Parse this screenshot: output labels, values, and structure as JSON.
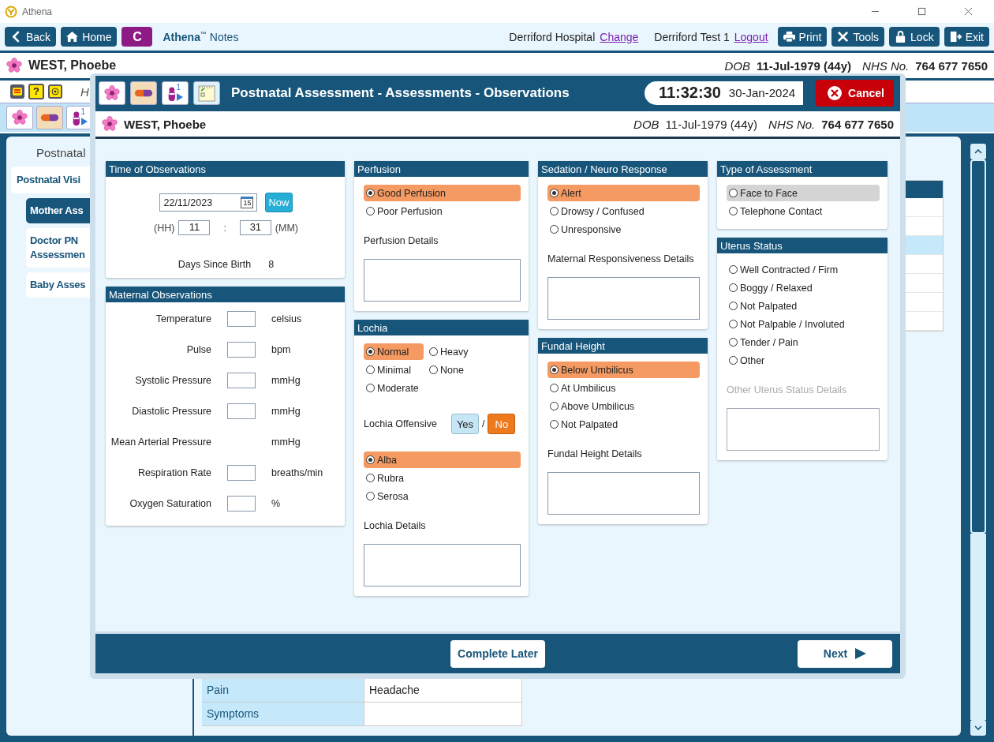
{
  "app": {
    "title": "Athena"
  },
  "toolbar": {
    "back": "Back",
    "home": "Home",
    "c_button": "C",
    "app_name": "Athena",
    "trademark": "™",
    "module": "Notes",
    "hospital": "Derriford Hospital",
    "change_link": "Change",
    "user": "Derriford Test 1",
    "logout_link": "Logout",
    "buttons": [
      {
        "kind": "print",
        "label": "Print"
      },
      {
        "kind": "tools",
        "label": "Tools"
      },
      {
        "kind": "lock",
        "label": "Lock"
      },
      {
        "kind": "exit",
        "label": "Exit"
      }
    ]
  },
  "patient": {
    "name": "WEST, Phoebe",
    "dob_label": "DOB",
    "dob": "11-Jul-1979 (44y)",
    "nhs_label": "NHS No.",
    "nhs": "764 677 7650"
  },
  "subheader": {
    "help_glyph": "?",
    "text": "H"
  },
  "icon_bar": {
    "badge": "1"
  },
  "nav": {
    "heading": "Postnatal",
    "items": [
      {
        "lines": [
          "Postnatal Visi"
        ],
        "selected": false,
        "children": [
          {
            "lines": [
              "Mother Ass"
            ],
            "selected": true
          },
          {
            "lines": [
              "Doctor PN",
              "Assessmen"
            ],
            "selected": false
          },
          {
            "lines": [
              "Baby Asses"
            ],
            "selected": false
          }
        ]
      }
    ]
  },
  "side_table": {
    "rows": [
      {
        "selected": false
      },
      {
        "selected": false
      },
      {
        "selected": true
      },
      {
        "selected": false
      },
      {
        "selected": false
      },
      {
        "selected": false
      },
      {
        "selected": false
      }
    ]
  },
  "bottom_table": {
    "rows": [
      {
        "label": "Pain",
        "value": "Headache"
      },
      {
        "label": "Symptoms"
      }
    ]
  },
  "modal": {
    "title": "Postnatal Assessment - Assessments - Observations",
    "badge": "1",
    "time": "11:32:30",
    "date": "30-Jan-2024",
    "cancel": "Cancel",
    "patient": {
      "name": "WEST, Phoebe",
      "dob_label": "DOB",
      "dob": "11-Jul-1979 (44y)",
      "nhs_label": "NHS No.",
      "nhs": "764 677 7650"
    },
    "columns": [
      [
        {
          "kind": "time",
          "title": "Time of Observations",
          "date": "22/11/2023",
          "calendar_day": "15",
          "now": "Now",
          "hh_label": "(HH)",
          "hour": "11",
          "separator": ":",
          "minute": "31",
          "mm_label": "(MM)",
          "days_label": "Days Since Birth",
          "days": "8"
        },
        {
          "kind": "measures",
          "title": "Maternal Observations",
          "rows": [
            {
              "label": "Temperature",
              "unit": "celsius",
              "has_input": true
            },
            {
              "label": "Pulse",
              "unit": "bpm",
              "has_input": true
            },
            {
              "label": "Systolic Pressure",
              "unit": "mmHg",
              "has_input": true
            },
            {
              "label": "Diastolic Pressure",
              "unit": "mmHg",
              "has_input": true
            },
            {
              "label": "Mean Arterial Pressure",
              "unit": "mmHg",
              "has_input": false
            },
            {
              "label": "Respiration Rate",
              "unit": "breaths/min",
              "has_input": true
            },
            {
              "label": "Oxygen Saturation",
              "unit": "%",
              "has_input": true
            }
          ]
        }
      ],
      [
        {
          "kind": "form",
          "title": "Perfusion",
          "blocks": [
            {
              "kind": "radios",
              "options": [
                {
                  "label": "Good Perfusion",
                  "selected": true
                },
                {
                  "label": "Poor Perfusion",
                  "selected": false
                }
              ]
            },
            {
              "kind": "details",
              "label": "Perfusion Details",
              "disabled": false
            }
          ]
        },
        {
          "kind": "form",
          "title": "Lochia",
          "blocks": [
            {
              "kind": "radio_grid",
              "options": [
                {
                  "label": "Normal",
                  "selected": true
                },
                {
                  "label": "Heavy",
                  "selected": false
                },
                {
                  "label": "Minimal",
                  "selected": false
                },
                {
                  "label": "None",
                  "selected": false
                },
                {
                  "label": "Moderate",
                  "selected": false
                }
              ]
            },
            {
              "kind": "toggle",
              "label": "Lochia Offensive",
              "separator": "/",
              "choices": [
                {
                  "label": "Yes",
                  "selected": false
                },
                {
                  "label": "No",
                  "selected": true
                }
              ]
            },
            {
              "kind": "radios",
              "options": [
                {
                  "label": "Alba",
                  "selected": true
                },
                {
                  "label": "Rubra",
                  "selected": false
                },
                {
                  "label": "Serosa",
                  "selected": false
                }
              ]
            },
            {
              "kind": "details",
              "label": "Lochia Details",
              "disabled": false
            }
          ]
        }
      ],
      [
        {
          "kind": "form",
          "title": "Sedation / Neuro Response",
          "blocks": [
            {
              "kind": "radios",
              "options": [
                {
                  "label": "Alert",
                  "selected": true
                },
                {
                  "label": "Drowsy / Confused",
                  "selected": false
                },
                {
                  "label": "Unresponsive",
                  "selected": false
                }
              ]
            },
            {
              "kind": "details",
              "label": "Maternal Responsiveness Details",
              "disabled": false
            }
          ]
        },
        {
          "kind": "form",
          "title": "Fundal Height",
          "blocks": [
            {
              "kind": "radios",
              "options": [
                {
                  "label": "Below Umbilicus",
                  "selected": true
                },
                {
                  "label": "At Umbilicus",
                  "selected": false
                },
                {
                  "label": "Above Umbilicus",
                  "selected": false
                },
                {
                  "label": "Not Palpated",
                  "selected": false
                }
              ]
            },
            {
              "kind": "details",
              "label": "Fundal Height Details",
              "disabled": false
            }
          ]
        }
      ],
      [
        {
          "kind": "form",
          "title": "Type of Assessment",
          "blocks": [
            {
              "kind": "radios",
              "options": [
                {
                  "label": "Face to Face",
                  "selected": false,
                  "focused": true
                },
                {
                  "label": "Telephone Contact",
                  "selected": false,
                  "focused": false
                }
              ]
            }
          ]
        },
        {
          "kind": "form",
          "title": "Uterus Status",
          "blocks": [
            {
              "kind": "radios",
              "options": [
                {
                  "label": "Well Contracted / Firm",
                  "selected": false
                },
                {
                  "label": "Boggy / Relaxed",
                  "selected": false
                },
                {
                  "label": "Not Palpated",
                  "selected": false
                },
                {
                  "label": "Not Palpable / Involuted",
                  "selected": false
                },
                {
                  "label": "Tender / Pain",
                  "selected": false
                },
                {
                  "label": "Other",
                  "selected": false
                }
              ]
            },
            {
              "kind": "details",
              "label": "Other Uterus Status Details",
              "disabled": true
            }
          ]
        }
      ]
    ],
    "complete_later": "Complete Later",
    "next": "Next"
  }
}
